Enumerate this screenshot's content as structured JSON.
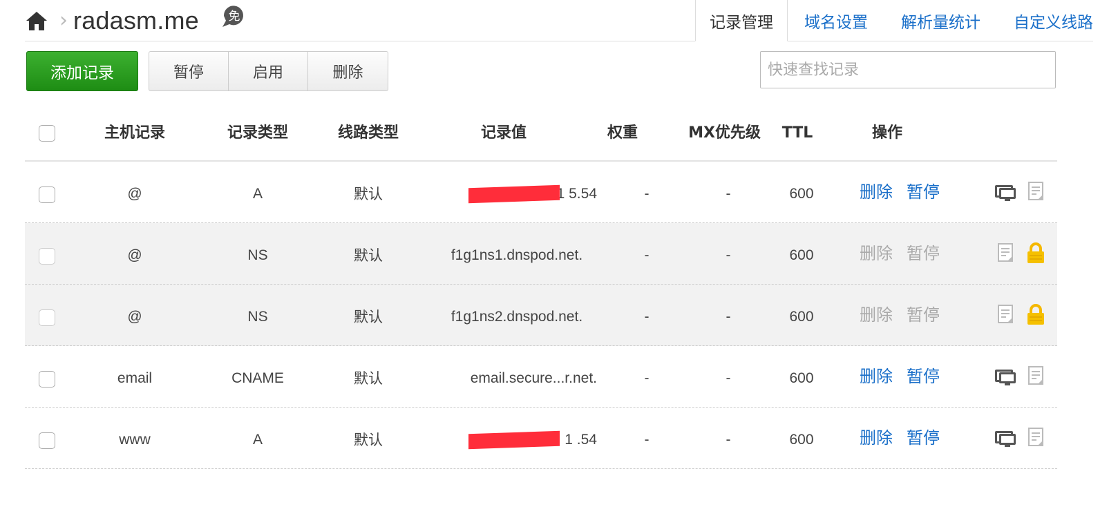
{
  "header": {
    "domain": "radasm.me",
    "badge": "免",
    "tabs": [
      {
        "label": "记录管理",
        "active": true
      },
      {
        "label": "域名设置",
        "active": false
      },
      {
        "label": "解析量统计",
        "active": false
      },
      {
        "label": "自定义线路",
        "active": false
      }
    ]
  },
  "toolbar": {
    "add_label": "添加记录",
    "pause_label": "暂停",
    "enable_label": "启用",
    "delete_label": "删除",
    "search_placeholder": "快速查找记录"
  },
  "table": {
    "columns": [
      "主机记录",
      "记录类型",
      "线路类型",
      "记录值",
      "权重",
      "MX优先级",
      "TTL",
      "操作"
    ],
    "rows": [
      {
        "host": "@",
        "type": "A",
        "line": "默认",
        "value": "1      5.54",
        "weight": "-",
        "mx": "-",
        "ttl": "600",
        "delete": "删除",
        "pause": "暂停",
        "system": false
      },
      {
        "host": "@",
        "type": "NS",
        "line": "默认",
        "value": "f1g1ns1.dnspod.net.",
        "weight": "-",
        "mx": "-",
        "ttl": "600",
        "delete": "删除",
        "pause": "暂停",
        "system": true
      },
      {
        "host": "@",
        "type": "NS",
        "line": "默认",
        "value": "f1g1ns2.dnspod.net.",
        "weight": "-",
        "mx": "-",
        "ttl": "600",
        "delete": "删除",
        "pause": "暂停",
        "system": true
      },
      {
        "host": "email",
        "type": "CNAME",
        "line": "默认",
        "value": "email.secure...r.net.",
        "weight": "-",
        "mx": "-",
        "ttl": "600",
        "delete": "删除",
        "pause": "暂停",
        "system": false
      },
      {
        "host": "www",
        "type": "A",
        "line": "默认",
        "value": "1      .54",
        "weight": "-",
        "mx": "-",
        "ttl": "600",
        "delete": "删除",
        "pause": "暂停",
        "system": false
      }
    ]
  },
  "colors": {
    "accent": "#1a6fc9",
    "add_button": "#2a9c1e",
    "redaction": "#ff2d3a",
    "lock": "#f5b800"
  },
  "icons": [
    "home-icon",
    "free-badge-icon",
    "monitor-icon",
    "note-icon",
    "lock-icon"
  ]
}
